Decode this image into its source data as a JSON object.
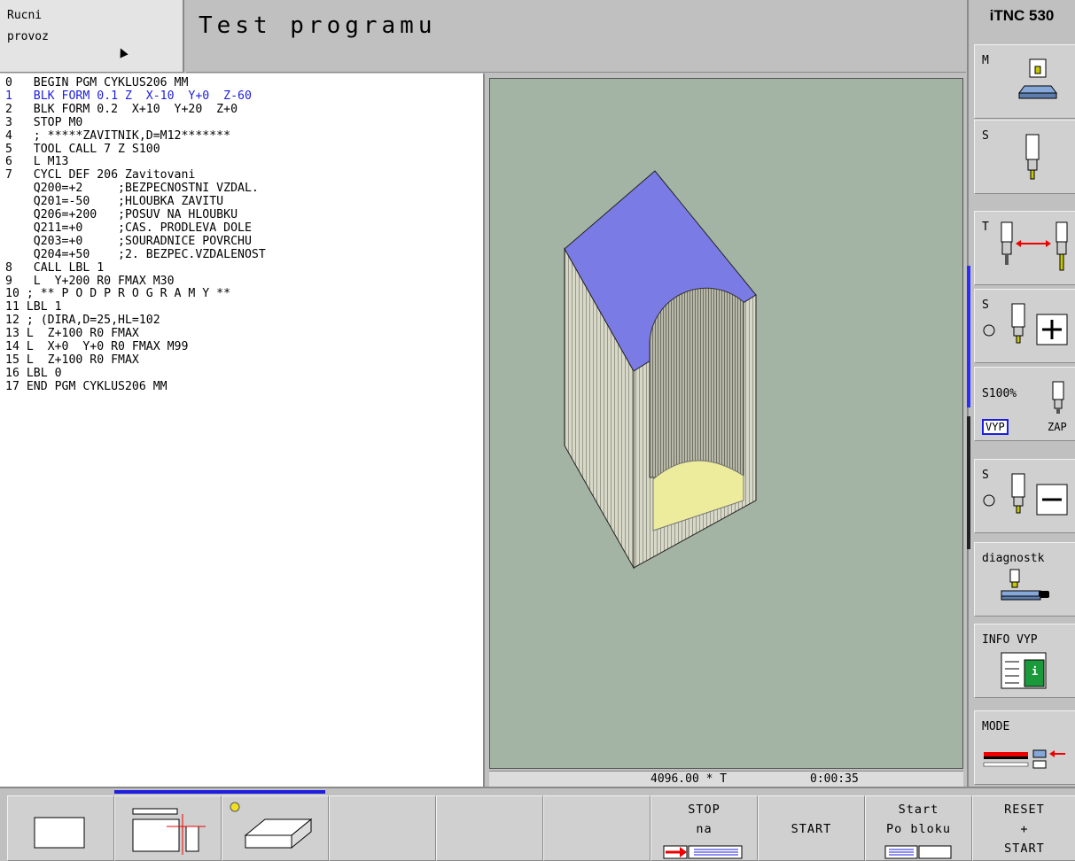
{
  "header": {
    "mode_line1": "Rucni",
    "mode_line2": "provoz",
    "title": "Test programu",
    "brand": "iTNC 530"
  },
  "program": {
    "lines": [
      {
        "text": "0   BEGIN PGM CYKLUS206 MM",
        "active": false
      },
      {
        "text": "1   BLK FORM 0.1 Z  X-10  Y+0  Z-60",
        "active": true
      },
      {
        "text": "2   BLK FORM 0.2  X+10  Y+20  Z+0",
        "active": false
      },
      {
        "text": "3   STOP M0",
        "active": false
      },
      {
        "text": "4   ; *****ZAVITNIK,D=M12*******",
        "active": false
      },
      {
        "text": "5   TOOL CALL 7 Z S100",
        "active": false
      },
      {
        "text": "6   L M13",
        "active": false
      },
      {
        "text": "7   CYCL DEF 206 Zavitovani",
        "active": false
      },
      {
        "text": "    Q200=+2     ;BEZPECNOSTNI VZDAL.",
        "active": false
      },
      {
        "text": "    Q201=-50    ;HLOUBKA ZAVITU",
        "active": false
      },
      {
        "text": "    Q206=+200   ;POSUV NA HLOUBKU",
        "active": false
      },
      {
        "text": "    Q211=+0     ;CAS. PRODLEVA DOLE",
        "active": false
      },
      {
        "text": "    Q203=+0     ;SOURADNICE POVRCHU",
        "active": false
      },
      {
        "text": "    Q204=+50    ;2. BEZPEC.VZDALENOST",
        "active": false
      },
      {
        "text": "8   CALL LBL 1",
        "active": false
      },
      {
        "text": "9   L  Y+200 R0 FMAX M30",
        "active": false
      },
      {
        "text": "10 ; ** P O D P R O G R A M Y **",
        "active": false
      },
      {
        "text": "11 LBL 1",
        "active": false
      },
      {
        "text": "12 ; (DIRA,D=25,HL=102",
        "active": false
      },
      {
        "text": "13 L  Z+100 R0 FMAX",
        "active": false
      },
      {
        "text": "14 L  X+0  Y+0 R0 FMAX M99",
        "active": false
      },
      {
        "text": "15 L  Z+100 R0 FMAX",
        "active": false
      },
      {
        "text": "16 LBL 0",
        "active": false
      },
      {
        "text": "17 END PGM CYKLUS206 MM",
        "active": false
      }
    ]
  },
  "status": {
    "value": "4096.00 * T",
    "time": "0:00:35"
  },
  "right_softkeys": [
    {
      "label": "M",
      "icon": "machine-table-icon"
    },
    {
      "label": "S",
      "icon": "spindle-icon"
    },
    {
      "label": "T",
      "icon": "tool-change-icon"
    },
    {
      "label": "S",
      "icon": "spindle-plus-icon"
    },
    {
      "label": "S100%",
      "icon": "spindle-override-icon",
      "off": "VYP",
      "on": "ZAP"
    },
    {
      "label": "S",
      "icon": "spindle-minus-icon"
    },
    {
      "label": "diagnostk",
      "icon": "diagnostics-icon"
    },
    {
      "label": "INFO  VYP",
      "icon": "info-icon",
      "badge": "i"
    },
    {
      "label": "MODE",
      "icon": "mode-icon"
    }
  ],
  "bottom_softkeys": [
    {
      "icon": "single-window-icon"
    },
    {
      "icon": "split-window-icon"
    },
    {
      "icon": "workpiece-3d-icon"
    },
    {},
    {},
    {},
    {
      "line1": "STOP",
      "line2": "na",
      "icon": "stop-at-block-icon"
    },
    {
      "line1": "START"
    },
    {
      "line1": "Start",
      "line2": "Po bloku",
      "icon": "block-icon"
    },
    {
      "line1": "RESET",
      "line2": "+",
      "line3": "START"
    }
  ],
  "colors": {
    "active_line": "#1d1de0",
    "graphics_bg": "#a4b4a4",
    "workpiece_top": "#7b7be6",
    "workpiece_side": "#d8d8c8",
    "hole_bottom": "#ecec9c"
  }
}
